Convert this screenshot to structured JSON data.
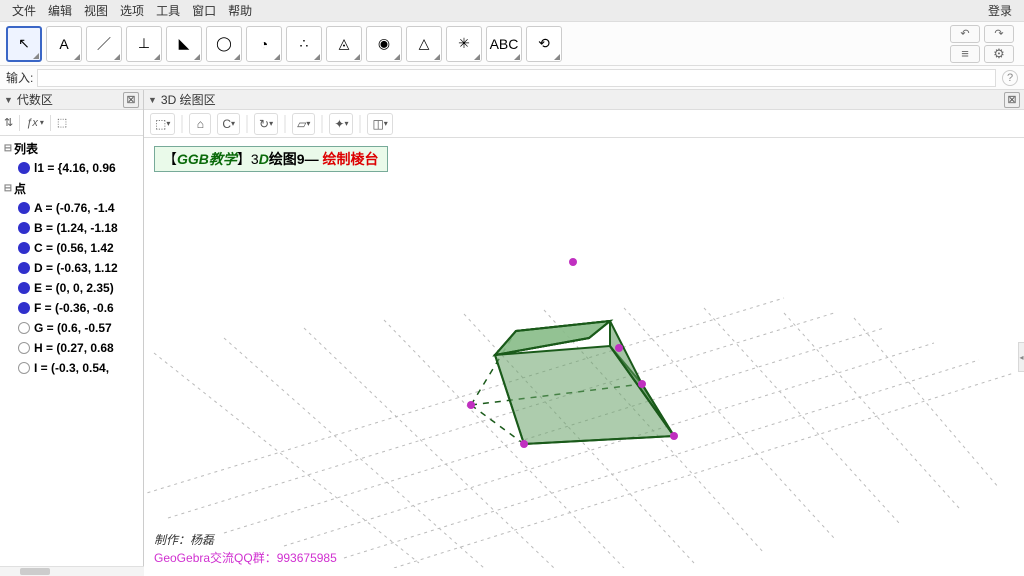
{
  "menubar": {
    "items": [
      "文件",
      "编辑",
      "视图",
      "选项",
      "工具",
      "窗口",
      "帮助"
    ],
    "login": "登录"
  },
  "toolbar": {
    "tools": [
      {
        "icon": "↖",
        "name": "move-tool",
        "selected": true
      },
      {
        "icon": "A",
        "name": "point-tool"
      },
      {
        "icon": "／",
        "name": "line-tool"
      },
      {
        "icon": "⊥",
        "name": "orthogonal-tool"
      },
      {
        "icon": "◣",
        "name": "polygon-tool"
      },
      {
        "icon": "◯",
        "name": "circle-axis-tool"
      },
      {
        "icon": "◔",
        "name": "ellipse-tool"
      },
      {
        "icon": "∴",
        "name": "intersect-tool"
      },
      {
        "icon": "◬",
        "name": "plane-tool"
      },
      {
        "icon": "◉",
        "name": "sphere-tool"
      },
      {
        "icon": "△",
        "name": "angle-tool"
      },
      {
        "icon": "✳",
        "name": "reflect-tool"
      },
      {
        "icon": "ABC",
        "name": "text-tool"
      },
      {
        "icon": "⟲",
        "name": "rotate-view-tool"
      }
    ],
    "undo": "↶",
    "redo": "↷",
    "props": "≡",
    "gear": "⚙"
  },
  "input": {
    "label": "输入:",
    "help": "?",
    "value": ""
  },
  "algebra": {
    "title": "代数区",
    "fx": "ƒx",
    "groups": [
      {
        "label": "列表",
        "items": [
          {
            "text": "l1 = {4.16, 0.96",
            "filled": true
          }
        ]
      },
      {
        "label": "点",
        "items": [
          {
            "text": "A = (-0.76, -1.4",
            "filled": true
          },
          {
            "text": "B = (1.24, -1.18",
            "filled": true
          },
          {
            "text": "C = (0.56, 1.42",
            "filled": true
          },
          {
            "text": "D = (-0.63, 1.12",
            "filled": true
          },
          {
            "text": "E = (0, 0, 2.35)",
            "filled": true
          },
          {
            "text": "F = (-0.36, -0.6",
            "filled": true
          },
          {
            "text": "G = (0.6, -0.57",
            "filled": false
          },
          {
            "text": "H = (0.27, 0.68",
            "filled": false
          },
          {
            "text": "I = (-0.3, 0.54,",
            "filled": false
          }
        ]
      }
    ]
  },
  "view3d": {
    "title": "3D 绘图区",
    "title_block": {
      "prefix": "【",
      "ital": "GGB教学",
      "mid": "】3",
      "ital2": "D",
      "after": "绘图9—",
      "red": "  绘制棱台"
    },
    "author": "制作：杨磊",
    "qq_label": "GeoGebra交流QQ群：993675985"
  }
}
